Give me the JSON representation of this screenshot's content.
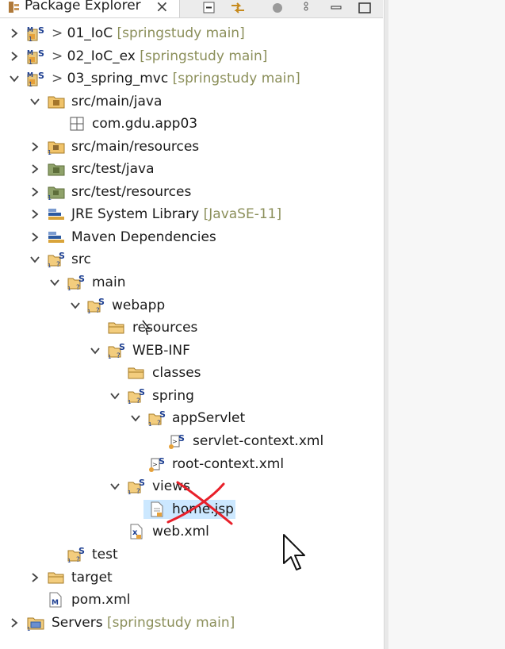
{
  "view": {
    "title": "Package Explorer",
    "close_glyph": "×",
    "toolbar": [
      "collapse-all-icon",
      "link-with-editor-icon",
      "filter-icon",
      "view-menu-icon",
      "minimize-icon"
    ]
  },
  "tree": [
    {
      "label": "01_IoC",
      "decoration": "[springstudy main]",
      "prefix": ">",
      "icon": "maven-project-icon",
      "arrow": "collapsed"
    },
    {
      "label": "02_IoC_ex",
      "decoration": "[springstudy main]",
      "prefix": ">",
      "icon": "maven-project-icon",
      "arrow": "collapsed"
    },
    {
      "label": "03_spring_mvc",
      "decoration": "[springstudy main]",
      "prefix": ">",
      "icon": "maven-project-icon",
      "arrow": "expanded"
    },
    {
      "label": "src/main/java",
      "icon": "source-folder-icon",
      "arrow": "expanded"
    },
    {
      "label": "com.gdu.app03",
      "icon": "package-icon",
      "arrow": "none"
    },
    {
      "label": "src/main/resources",
      "icon": "resource-folder-icon",
      "arrow": "collapsed"
    },
    {
      "label": "src/test/java",
      "icon": "test-source-folder-icon",
      "arrow": "collapsed"
    },
    {
      "label": "src/test/resources",
      "icon": "test-resource-folder-icon",
      "arrow": "collapsed"
    },
    {
      "label": "JRE System Library",
      "decoration": "[JavaSE-11]",
      "icon": "library-icon",
      "arrow": "collapsed"
    },
    {
      "label": "Maven Dependencies",
      "icon": "library-icon",
      "arrow": "collapsed"
    },
    {
      "label": "src",
      "icon": "folder-icon",
      "arrow": "expanded"
    },
    {
      "label": "main",
      "icon": "folder-icon",
      "arrow": "expanded"
    },
    {
      "label": "webapp",
      "icon": "folder-icon",
      "arrow": "expanded"
    },
    {
      "label": "resources",
      "icon": "plain-folder-icon",
      "arrow": "none"
    },
    {
      "label": "WEB-INF",
      "icon": "folder-icon",
      "arrow": "expanded"
    },
    {
      "label": "classes",
      "icon": "plain-folder-icon",
      "arrow": "none"
    },
    {
      "label": "spring",
      "icon": "folder-icon",
      "arrow": "expanded"
    },
    {
      "label": "appServlet",
      "icon": "folder-icon",
      "arrow": "expanded"
    },
    {
      "label": "servlet-context.xml",
      "icon": "spring-xml-icon",
      "arrow": "none"
    },
    {
      "label": "root-context.xml",
      "icon": "spring-xml-icon",
      "arrow": "none"
    },
    {
      "label": "views",
      "icon": "folder-icon",
      "arrow": "expanded"
    },
    {
      "label": "home.jsp",
      "icon": "jsp-file-icon",
      "arrow": "none",
      "selected": true
    },
    {
      "label": "web.xml",
      "icon": "xml-file-icon",
      "arrow": "none"
    },
    {
      "label": "test",
      "icon": "folder-icon",
      "arrow": "none"
    },
    {
      "label": "target",
      "icon": "plain-folder-icon",
      "arrow": "collapsed"
    },
    {
      "label": "pom.xml",
      "icon": "maven-pom-icon",
      "arrow": "none"
    },
    {
      "label": "Servers",
      "decoration": "[springstudy main]",
      "icon": "servers-project-icon",
      "arrow": "collapsed"
    }
  ]
}
